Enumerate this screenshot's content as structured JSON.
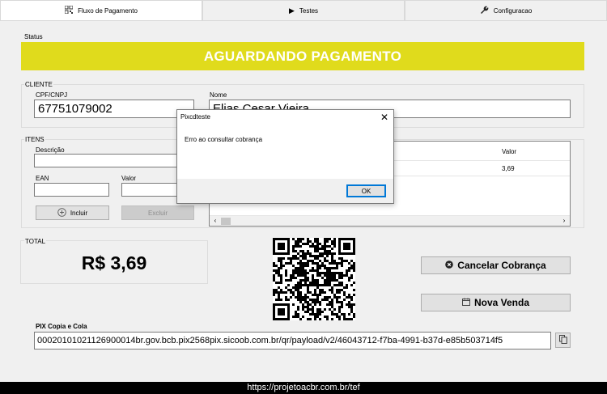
{
  "tabs": [
    {
      "label": "Fluxo de Pagamento",
      "icon": "qr-code-icon",
      "active": true
    },
    {
      "label": "Testes",
      "icon": "play-icon",
      "active": false
    },
    {
      "label": "Configuracao",
      "icon": "wrench-icon",
      "active": false
    }
  ],
  "status": {
    "label": "Status",
    "text": "AGUARDANDO PAGAMENTO",
    "color": "#e0db1c"
  },
  "cliente": {
    "group_label": "CLIENTE",
    "cpf_label": "CPF/CNPJ",
    "cpf_value": "67751079002",
    "nome_label": "Nome",
    "nome_value": "Elias Cesar Vieira"
  },
  "itens": {
    "group_label": "ITENS",
    "descricao_label": "Descrição",
    "descricao_value": "",
    "ean_label": "EAN",
    "ean_value": "",
    "valor_label": "Valor",
    "valor_value": "",
    "incluir_label": "Incluir",
    "excluir_label": "Excluir",
    "grid": {
      "columns": [
        "Valor"
      ],
      "rows": [
        {
          "valor": "3,69"
        }
      ]
    }
  },
  "total": {
    "label": "TOTAL",
    "value": "R$ 3,69"
  },
  "actions": {
    "cancelar_label": "Cancelar Cobrança",
    "nova_venda_label": "Nova Venda"
  },
  "pix": {
    "label": "PIX Copia e Cola",
    "value": "00020101021126900014br.gov.bcb.pix2568pix.sicoob.com.br/qr/payload/v2/46043712-f7ba-4991-b37d-e85b503714f5"
  },
  "dialog": {
    "title": "Pixcdteste",
    "message": "Erro ao consultar cobrança",
    "ok_label": "OK"
  },
  "footer": {
    "url": "https://projetoacbr.com.br/tef"
  }
}
